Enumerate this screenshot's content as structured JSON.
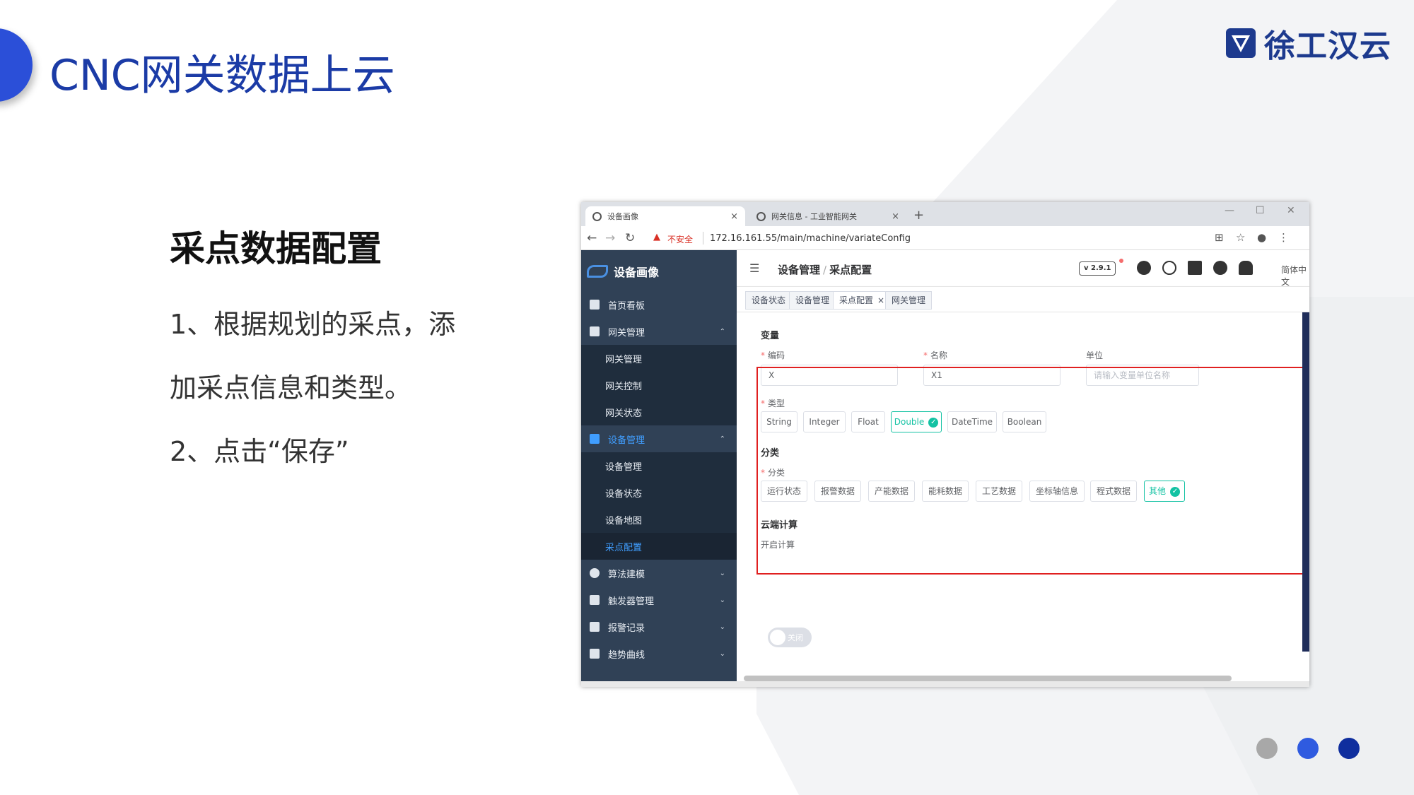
{
  "slide": {
    "title": "CNC网关数据上云",
    "logo_text": "徐工汉云",
    "heading": "采点数据配置",
    "lines": [
      "1、根据规划的采点，添",
      "加采点信息和类型。",
      "2、点击“保存”"
    ],
    "dot_colors": [
      "#a8a8a8",
      "#2f5be0",
      "#0f2e9e"
    ]
  },
  "browser": {
    "tabs": [
      {
        "label": "设备画像",
        "close": "×"
      },
      {
        "label": "网关信息 - 工业智能网关",
        "close": "×"
      }
    ],
    "new_tab": "+",
    "window_controls": [
      "—",
      "☐",
      "✕"
    ],
    "insecure_label": "不安全",
    "url": "172.16.161.55/main/machine/variateConfig"
  },
  "app": {
    "brand": "设备画像",
    "breadcrumb": {
      "parent": "设备管理",
      "separator": "/",
      "current": "采点配置"
    },
    "version": "v 2.9.1",
    "language": "简体中文",
    "menu": [
      {
        "label": "首页看板",
        "caret": ""
      },
      {
        "label": "网关管理",
        "caret": "⌃"
      },
      {
        "label": "网关管理",
        "sub": true
      },
      {
        "label": "网关控制",
        "sub": true
      },
      {
        "label": "网关状态",
        "sub": true
      },
      {
        "label": "设备管理",
        "caret": "⌃"
      },
      {
        "label": "设备管理",
        "sub": true
      },
      {
        "label": "设备状态",
        "sub": true
      },
      {
        "label": "设备地图",
        "sub": true
      },
      {
        "label": "采点配置",
        "sub": true
      },
      {
        "label": "算法建模",
        "caret": "⌄"
      },
      {
        "label": "触发器管理",
        "caret": "⌄"
      },
      {
        "label": "报警记录",
        "caret": "⌄"
      },
      {
        "label": "趋势曲线",
        "caret": "⌄"
      }
    ],
    "tags": [
      "设备状态",
      "设备管理",
      "采点配置",
      "网关管理"
    ],
    "tag_close": "×",
    "form": {
      "section_variable": "变量",
      "code_label": "编码",
      "code_value": "X",
      "name_label": "名称",
      "name_value": "X1",
      "unit_label": "单位",
      "unit_placeholder": "请输入变量单位名称",
      "type_label": "类型",
      "types": [
        "String",
        "Integer",
        "Float",
        "Double",
        "DateTime",
        "Boolean"
      ],
      "type_selected": "Double",
      "section_category": "分类",
      "category_label": "分类",
      "categories": [
        "运行状态",
        "报警数据",
        "产能数据",
        "能耗数据",
        "工艺数据",
        "坐标轴信息",
        "程式数据",
        "其他"
      ],
      "category_selected": "其他",
      "section_cloud": "云端计算",
      "calc_label": "开启计算",
      "toggle_text": "关闭",
      "check_mark": "✓"
    }
  }
}
